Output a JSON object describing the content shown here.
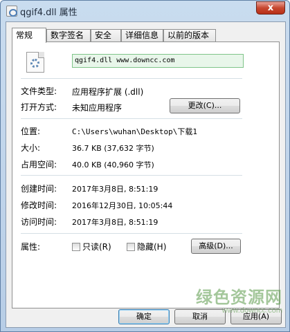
{
  "window": {
    "title": "qgif4.dll 属性",
    "close_label": "x"
  },
  "tabs": [
    {
      "label": "常规",
      "active": true
    },
    {
      "label": "数字签名",
      "active": false
    },
    {
      "label": "安全",
      "active": false
    },
    {
      "label": "详细信息",
      "active": false
    },
    {
      "label": "以前的版本",
      "active": false
    }
  ],
  "general": {
    "file_name": "qgif4.dll   www.downcc.com",
    "file_type_label": "文件类型:",
    "file_type_value": "应用程序扩展 (.dll)",
    "open_with_label": "打开方式:",
    "open_with_value": "未知应用程序",
    "change_button": "更改(C)...",
    "location_label": "位置:",
    "location_value": "C:\\Users\\wuhan\\Desktop\\下载1",
    "size_label": "大小:",
    "size_value": "36.7 KB (37,632 字节)",
    "disk_size_label": "占用空间:",
    "disk_size_value": "40.0 KB (40,960 字节)",
    "created_label": "创建时间:",
    "created_value": "2017年3月8日, 8:51:19",
    "modified_label": "修改时间:",
    "modified_value": "2016年12月30日, 10:05:44",
    "accessed_label": "访问时间:",
    "accessed_value": "2017年3月8日, 8:51:19",
    "attributes_label": "属性:",
    "readonly_label": "只读(R)",
    "hidden_label": "隐藏(H)",
    "advanced_button": "高级(D)...",
    "readonly_checked": false,
    "hidden_checked": false
  },
  "footer": {
    "ok_button": "确定",
    "cancel_button": "取消",
    "apply_button": "应用(A)"
  },
  "watermark": {
    "title": "绿色资源网",
    "url": "www.downcc.com"
  }
}
